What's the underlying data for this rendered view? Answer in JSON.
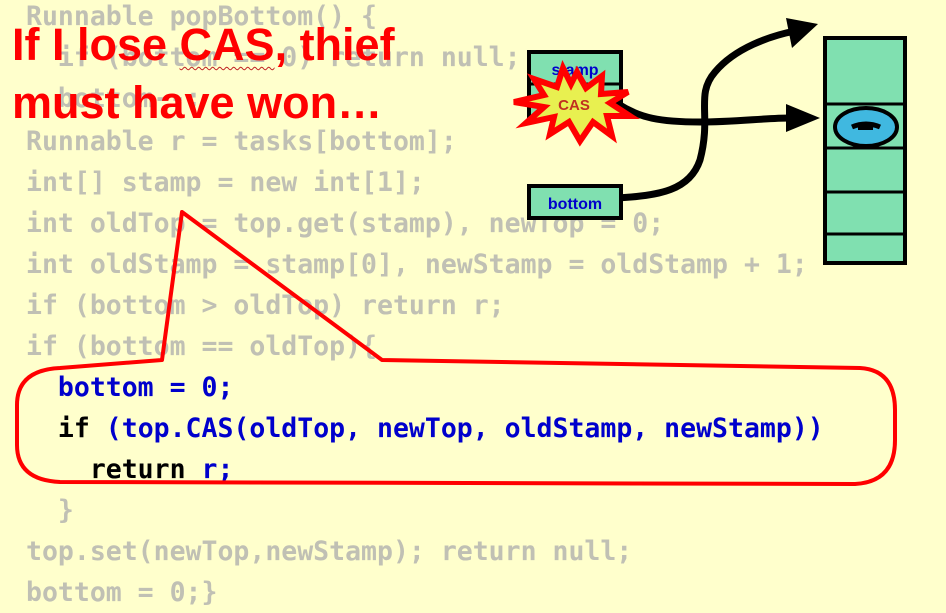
{
  "title": {
    "line1_before": "If I lose ",
    "line1_cas": "CAS",
    "line1_after": ", thief",
    "line2": "must have won…"
  },
  "code": {
    "line0": "Runnable popBottom() {",
    "line1": "  if (bottom == 0) return null;",
    "line2": "  bottom--;",
    "line3": "Runnable r = tasks[bottom];",
    "line4": "int[] stamp = new int[1];",
    "line5": "int oldTop = top.get(stamp), newTop = 0;",
    "line6": "int oldStamp = stamp[0], newStamp = oldStamp + 1;",
    "line7": "if (bottom > oldTop) return r;",
    "line8": "if (bottom == oldTop){",
    "line9": "  bottom = 0;",
    "line10_kw": "  if ",
    "line10_rest": "(top.CAS(oldTop, newTop, oldStamp, newStamp))",
    "line11_kw": "    return ",
    "line11_rest": "r;",
    "line12": "  }",
    "line13": "top.set(newTop,newStamp); return null;",
    "line14": "bottom = 0;}"
  },
  "diagram": {
    "stamp_label": "stamp",
    "cas_label": "CAS",
    "bottom_label": "bottom",
    "colors": {
      "cell_fill": "#80e0b0",
      "label_blue": "#0000cc",
      "star_red": "#ff0000",
      "star_yellow": "#e8f050",
      "task_blue": "#40b8e0",
      "callout_red": "#ff0000"
    }
  }
}
